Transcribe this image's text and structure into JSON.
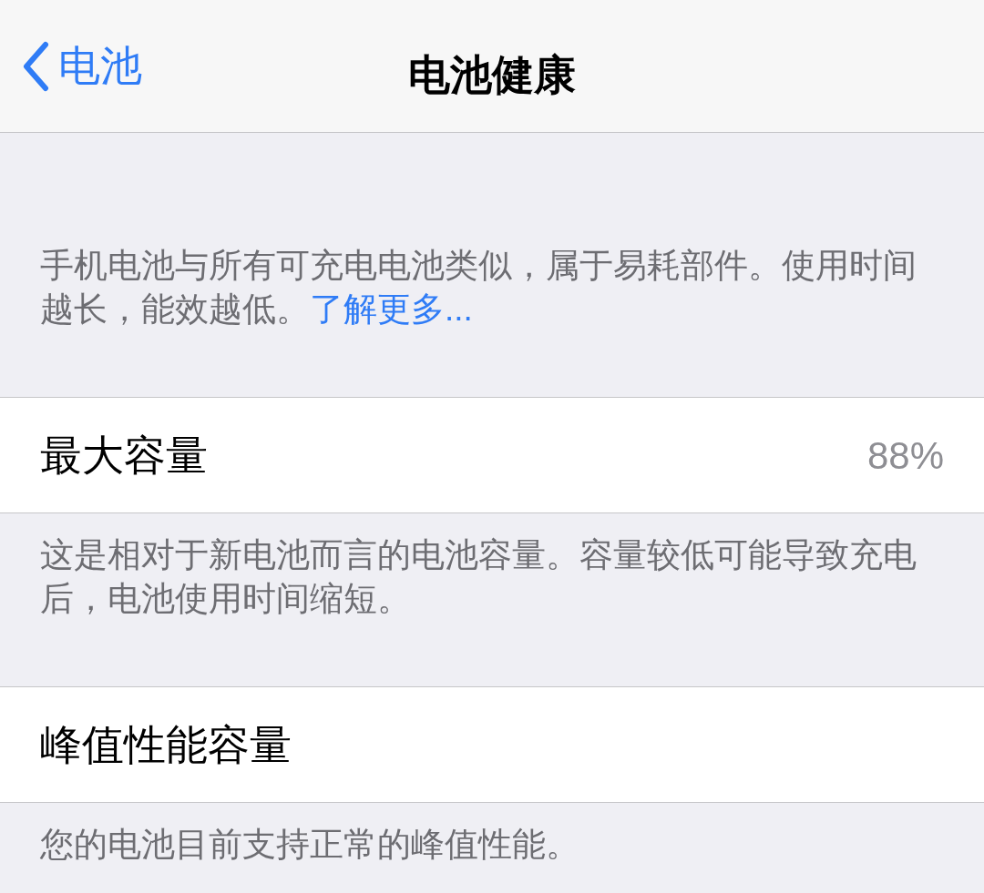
{
  "nav_bar": {
    "back_label": "电池",
    "title": "电池健康"
  },
  "intro": {
    "text": "手机电池与所有可充电电池类似，属于易耗部件。使用时间越长，能效越低。",
    "link": "了解更多..."
  },
  "sections": [
    {
      "label": "最大容量",
      "value": "88%",
      "footer": "这是相对于新电池而言的电池容量。容量较低可能导致充电后，电池使用时间缩短。"
    },
    {
      "label": "峰值性能容量",
      "footer": "您的电池目前支持正常的峰值性能。"
    }
  ]
}
